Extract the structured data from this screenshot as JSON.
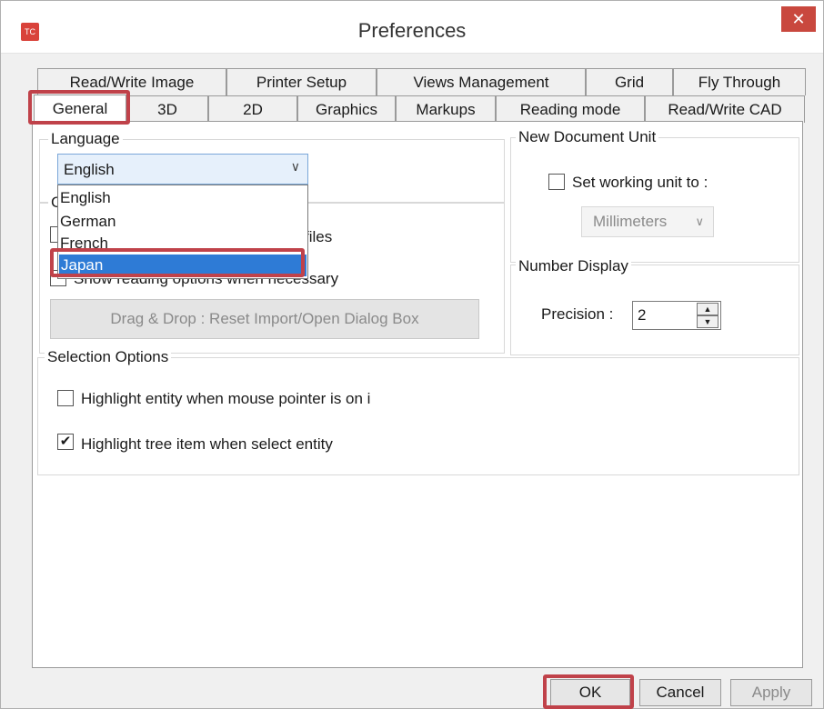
{
  "window": {
    "title": "Preferences",
    "logo_text": "TC",
    "close_glyph": "✕"
  },
  "tabs_row1": [
    {
      "label": "Read/Write Image"
    },
    {
      "label": "Printer Setup"
    },
    {
      "label": "Views Management"
    },
    {
      "label": "Grid"
    },
    {
      "label": "Fly Through"
    }
  ],
  "tabs_row2": [
    {
      "label": "General",
      "active": true
    },
    {
      "label": "3D"
    },
    {
      "label": "2D"
    },
    {
      "label": "Graphics"
    },
    {
      "label": "Markups"
    },
    {
      "label": "Reading mode"
    },
    {
      "label": "Read/Write CAD"
    }
  ],
  "language": {
    "group_label": "Language",
    "selected": "English",
    "options": [
      "English",
      "German",
      "French",
      "Japan"
    ],
    "highlighted_option": "Japan"
  },
  "other_group": {
    "label_fragment": "C",
    "option1_visible_tail": "files",
    "option2_label": "Show reading options when necessary",
    "drag_drop_button": "Drag & Drop : Reset Import/Open Dialog Box"
  },
  "new_document_unit": {
    "group_label": "New Document Unit",
    "checkbox_label": "Set working unit to :",
    "checked": false,
    "unit_value": "Millimeters"
  },
  "number_display": {
    "group_label": "Number Display",
    "precision_label": "Precision :",
    "precision_value": "2"
  },
  "selection_options": {
    "group_label": "Selection Options",
    "items": [
      {
        "label": "Highlight entity when mouse pointer is on i",
        "checked": false
      },
      {
        "label": "Highlight tree item when select entity",
        "checked": true
      }
    ]
  },
  "buttons": {
    "ok": "OK",
    "cancel": "Cancel",
    "apply": "Apply"
  },
  "colors": {
    "highlight_outline": "#c0424a",
    "selection_blue": "#2e7bd6",
    "close_button": "#c9483e"
  }
}
